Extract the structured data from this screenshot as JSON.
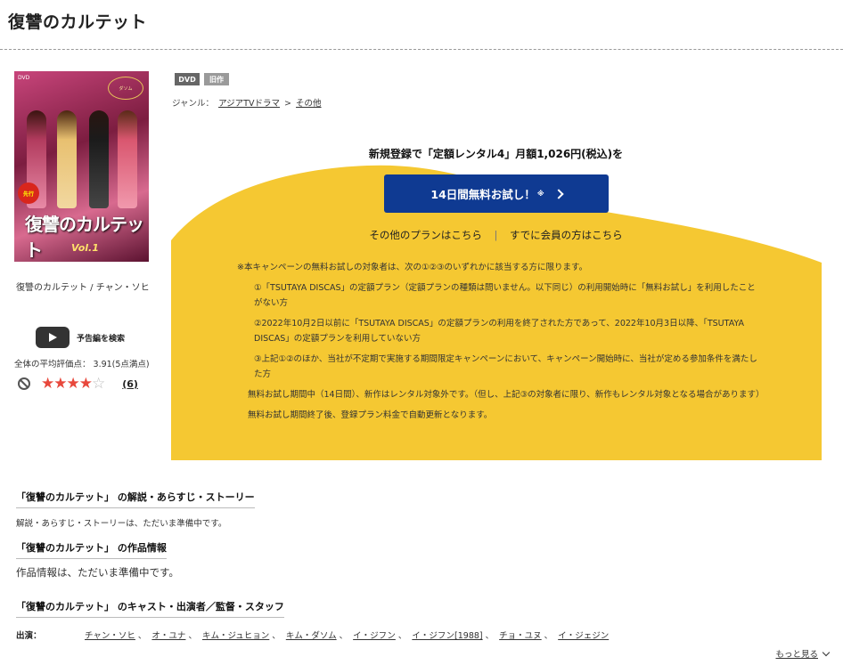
{
  "page": {
    "title": "復讐のカルテット"
  },
  "cover": {
    "dvd_mark": "DVD",
    "promo_badge": "ダソム",
    "sticker": "先行",
    "title": "復讐のカルテット",
    "vol": "Vol.1"
  },
  "product": {
    "caption": "復讐のカルテット / チャン・ソヒ",
    "trailer_label": "予告編を検索",
    "avg_rating_text": "全体の平均評価点： 3.91(5点満点)",
    "rating": 3.91,
    "stars": {
      "on": "★★★★",
      "off": "☆"
    },
    "review_count": "(6)"
  },
  "badges": {
    "dvd": "DVD",
    "old": "旧作"
  },
  "genre": {
    "label": "ジャンル：",
    "primary": "アジアTVドラマ",
    "arrow": ">",
    "secondary": "その他"
  },
  "promo": {
    "heading": "新規登録で「定額レンタル4」月額1,026円(税込)を",
    "cta_label": "14日間無料お試し！",
    "cta_note": "※",
    "other_plans": "その他のプランはこちら",
    "separator": "|",
    "members": "すでに会員の方はこちら",
    "color_yellow": "#f5c832",
    "color_button": "#0f3a92"
  },
  "notes": {
    "lead": "※本キャンペーンの無料お試しの対象者は、次の①②③のいずれかに該当する方に限ります。",
    "item1": "①「TSUTAYA DISCAS」の定額プラン（定額プランの種類は問いません。以下同じ）の利用開始時に「無料お試し」を利用したことがない方",
    "item2": "②2022年10月2日以前に「TSUTAYA DISCAS」の定額プランの利用を終了された方であって、2022年10月3日以降、「TSUTAYA DISCAS」の定額プランを利用していない方",
    "item3": "③上記①②のほか、当社が不定期で実施する期間限定キャンペーンにおいて、キャンペーン開始時に、当社が定める参加条件を満たした方",
    "trial": "無料お試し期間中（14日間）、新作はレンタル対象外です。（但し、上記③の対象者に限り、新作もレンタル対象となる場合があります）",
    "renewal": "無料お試し期間終了後、登録プラン料金で自動更新となります。"
  },
  "sections": {
    "story_head": "「復讐のカルテット」 の解説・あらすじ・ストーリー",
    "story_text": "解説・あらすじ・ストーリーは、ただいま準備中です。",
    "info_head": "「復讐のカルテット」 の作品情報",
    "info_text": "作品情報は、ただいま準備中です。",
    "cast_head": "「復讐のカルテット」 のキャスト・出演者／監督・スタッフ",
    "cast_label": "出演：",
    "cast": [
      "チャン・ソヒ",
      "オ・ユナ",
      "キム・ジュヒョン",
      "キム・ダソム",
      "イ・ジフン",
      "イ・ジフン[1988]",
      "チョ・ユヌ",
      "イ・ジェジン"
    ],
    "more": "もっと見る"
  }
}
